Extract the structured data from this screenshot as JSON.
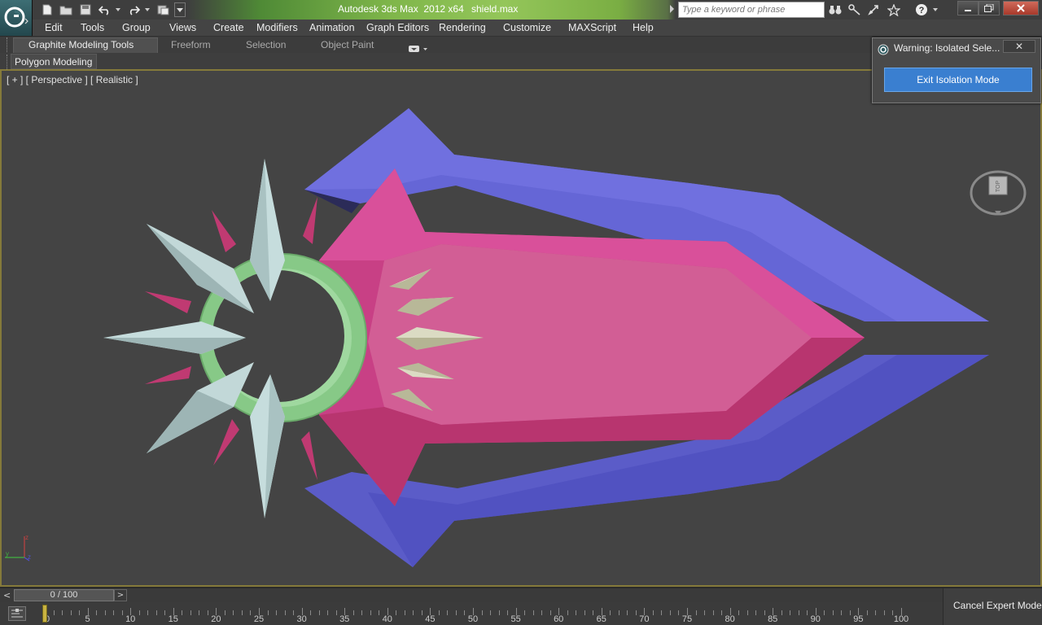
{
  "window": {
    "title": "Autodesk 3ds Max  2012 x64",
    "file": "shield.max",
    "search_placeholder": "Type a keyword or phrase"
  },
  "menu": {
    "items": [
      "Edit",
      "Tools",
      "Group",
      "Views",
      "Create",
      "Modifiers",
      "Animation",
      "Graph Editors",
      "Rendering",
      "Customize",
      "MAXScript",
      "Help"
    ]
  },
  "ribbon": {
    "tabs": [
      "Graphite Modeling Tools",
      "Freeform",
      "Selection",
      "Object Paint"
    ],
    "panel": "Polygon Modeling"
  },
  "viewport": {
    "label": "[ + ] [ Perspective ] [ Realistic ]",
    "viewcube_face": "TOP",
    "background": "#444444",
    "colors": {
      "outer_shell": "#6a6ad8",
      "inner_plate": "#d04e8c",
      "ring": "#8bd08b",
      "spikes": "#c2dcdc",
      "small_spikes": "#d6d6b8",
      "red_spikes": "#c03a72"
    }
  },
  "warning": {
    "title": "Warning: Isolated Sele...",
    "close_label": "✕",
    "button": "Exit Isolation Mode"
  },
  "timeline": {
    "slider_label": "0 / 100",
    "left_arrow": "<",
    "right_arrow": ">",
    "tick_labels": [
      "0",
      "5",
      "10",
      "15",
      "20",
      "25",
      "30",
      "35",
      "40",
      "45",
      "50",
      "55",
      "60",
      "65",
      "70",
      "75",
      "80",
      "85",
      "90",
      "95",
      "100"
    ]
  },
  "status": {
    "cancel_expert": "Cancel Expert Mode"
  }
}
